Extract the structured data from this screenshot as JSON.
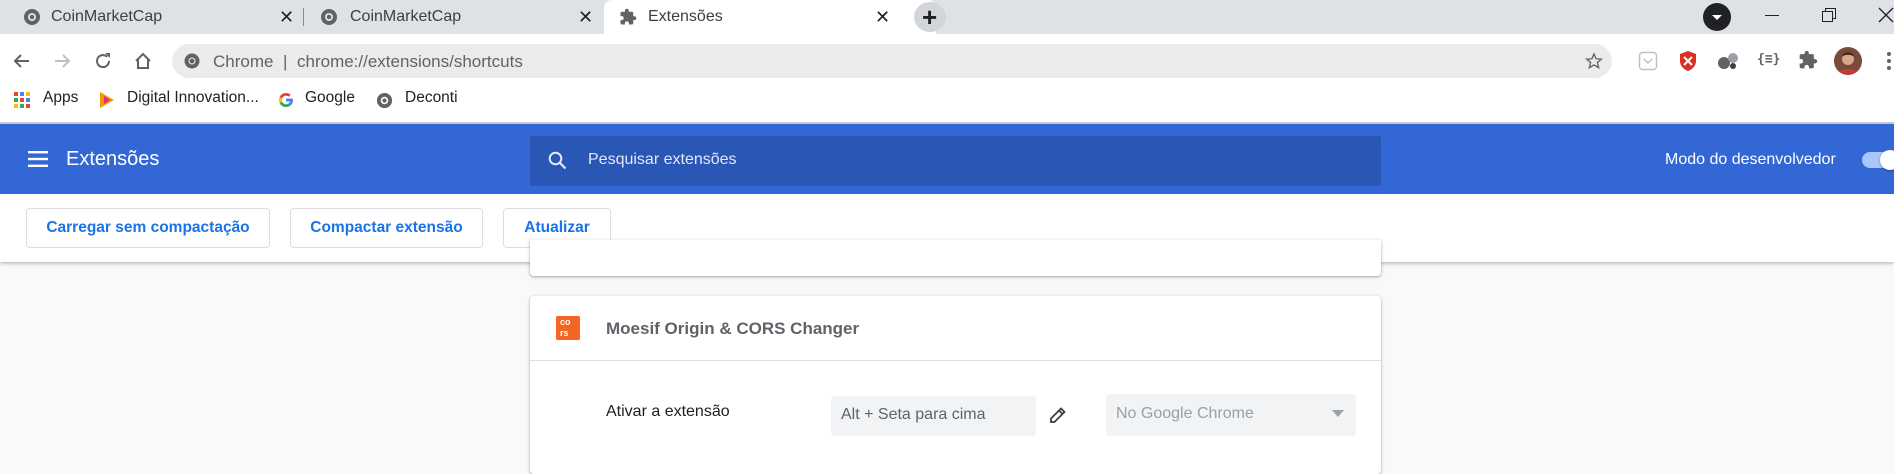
{
  "tabs": [
    {
      "title": "CoinMarketCap",
      "close": "✕"
    },
    {
      "title": "CoinMarketCap",
      "close": "✕"
    },
    {
      "title": "Extensões",
      "close": "✕"
    }
  ],
  "new_tab": "+",
  "omnibox": {
    "scheme_label": "Chrome",
    "separator": "|",
    "url": "chrome://extensions/shortcuts"
  },
  "bookmarks": [
    {
      "label": "Apps",
      "icon": "apps-grid-icon"
    },
    {
      "label": "Digital Innovation...",
      "icon": "dio-icon"
    },
    {
      "label": "Google",
      "icon": "google-icon"
    },
    {
      "label": "Deconti",
      "icon": "globe-icon"
    }
  ],
  "extensions_page": {
    "title": "Extensões",
    "search_placeholder": "Pesquisar extensões",
    "developer_mode_label": "Modo do desenvolvedor",
    "developer_mode_on": true,
    "actions": [
      "Carregar sem compactação",
      "Compactar extensão",
      "Atualizar"
    ]
  },
  "extension_card": {
    "name": "Moesif Origin & CORS Changer",
    "logo_text": [
      "co",
      "rs"
    ],
    "shortcut_label": "Ativar a extensão",
    "shortcut_value": "Alt + Seta para cima",
    "scope_value": "No Google Chrome"
  },
  "colors": {
    "header": "#3367d6",
    "search": "#2a56b6",
    "accent": "#1a73e8",
    "logo": "#f26522"
  }
}
